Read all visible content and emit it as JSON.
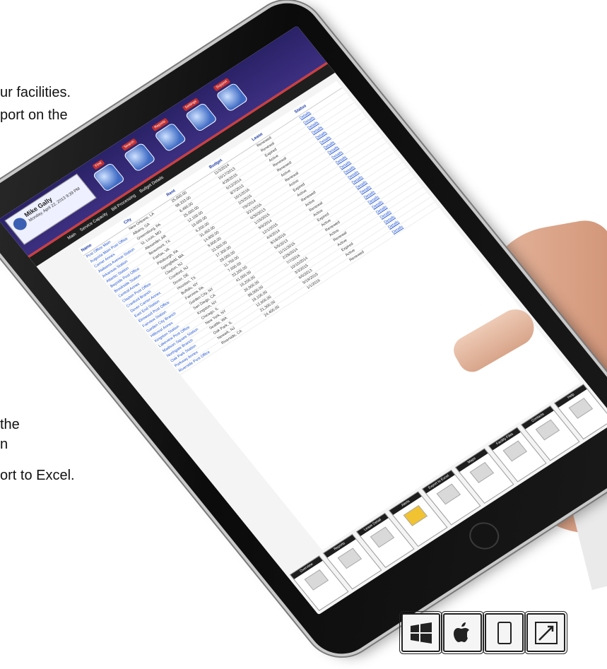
{
  "slide_text": {
    "line1": "ur facilities.",
    "line2": "port on the",
    "line3": "the",
    "line4": "n",
    "line5": "ort to Excel."
  },
  "app": {
    "user_name": "Mike Gally",
    "user_date": "Monday, April 22, 2013 9:39 PM",
    "toolbar": [
      "Find",
      "Search",
      "Reports",
      "Settings",
      "Support"
    ],
    "nav_tabs": [
      "Main",
      "Service Capacity",
      "Bill Processing",
      "Budget Details"
    ],
    "columns": [
      "Name",
      "City",
      "Rent",
      "Budget",
      "Lease",
      "Status"
    ],
    "rows": [
      [
        "Post Office Main",
        "New Orleans, LA",
        "25,000.00",
        "11/3/2014",
        "Renewed",
        "Details"
      ],
      [
        "Augusta Main Post Office",
        "Albany, GA",
        "98,333.00",
        "10/17/2013",
        "Renewal",
        "Details"
      ],
      [
        "Carrier Annex",
        "Greensburg, PA",
        "8,490.00",
        "4/28/2015",
        "Expired",
        "Details"
      ],
      [
        "Alabama Avenue Station",
        "St. Louis, MO",
        "25,000.00",
        "5/12/2014",
        "Active",
        "Details"
      ],
      [
        "Arkansas Station",
        "Alexander, AR",
        "12,100.00",
        "8/7/2013",
        "Renewal",
        "Details"
      ],
      [
        "Atlantic Station",
        "Beaumont, TX",
        "19,600.00",
        "10/1/2016",
        "Renewed",
        "Details"
      ],
      [
        "Bayside Post Office",
        "Fairfax, VA",
        "6,200.00",
        "2/3/2015",
        "Active",
        "Details"
      ],
      [
        "Brookside Station",
        "Pittsburgh, PA",
        "31,450.00",
        "7/9/2014",
        "Renewal",
        "Details"
      ],
      [
        "Central Annex",
        "Springfield, MA",
        "14,800.00",
        "3/21/2016",
        "Active",
        "Details"
      ],
      [
        "Clayton Post Office",
        "Clayton, NJ",
        "9,900.00",
        "6/30/2013",
        "Expired",
        "Details"
      ],
      [
        "Cranford Branch",
        "Cranford, NJ",
        "22,500.00",
        "1/15/2015",
        "Active",
        "Details"
      ],
      [
        "Dover Carrier Annex",
        "Dover, DE",
        "17,300.00",
        "9/9/2014",
        "Renewed",
        "Details"
      ],
      [
        "East End Station",
        "Houston, TX",
        "28,000.00",
        "12/1/2015",
        "Active",
        "Details"
      ],
      [
        "Elmwood Post Office",
        "Buffalo, NY",
        "11,750.00",
        "4/4/2014",
        "Renewal",
        "Details"
      ],
      [
        "Fairview Station",
        "Fairview, PA",
        "7,600.00",
        "8/18/2016",
        "Active",
        "Details"
      ],
      [
        "Garden City Branch",
        "Garden City, NY",
        "33,200.00",
        "5/5/2013",
        "Expired",
        "Details"
      ],
      [
        "Hillcrest Annex",
        "San Diego, CA",
        "41,000.00",
        "11/11/2015",
        "Active",
        "Details"
      ],
      [
        "Kingston Station",
        "Kingston, NY",
        "15,200.00",
        "2/28/2014",
        "Renewed",
        "Details"
      ],
      [
        "Lakeview Post Office",
        "Chicago, IL",
        "26,900.00",
        "7/7/2016",
        "Active",
        "Details"
      ],
      [
        "Madison Square Station",
        "New York, NY",
        "88,000.00",
        "10/10/2014",
        "Renewal",
        "Details"
      ],
      [
        "Northgate Branch",
        "Seattle, WA",
        "19,100.00",
        "3/3/2015",
        "Active",
        "Details"
      ],
      [
        "Oak Park Station",
        "Oak Park, IL",
        "12,600.00",
        "6/6/2013",
        "Expired",
        "Details"
      ],
      [
        "Parkway Annex",
        "Newark, NJ",
        "21,300.00",
        "9/19/2015",
        "Active",
        "Details"
      ],
      [
        "Riverside Post Office",
        "Riverside, CA",
        "24,400.00",
        "1/1/2016",
        "Renewed",
        "Details"
      ]
    ],
    "bottom_tabs": [
      "Overview",
      "Reports",
      "Lease Detail",
      "Alerts",
      "Export to Excel",
      "Maps",
      "Facility Files",
      "Contacts",
      "Help"
    ]
  },
  "platforms": [
    "windows-icon",
    "apple-icon",
    "tablet-icon",
    "resize-icon"
  ]
}
